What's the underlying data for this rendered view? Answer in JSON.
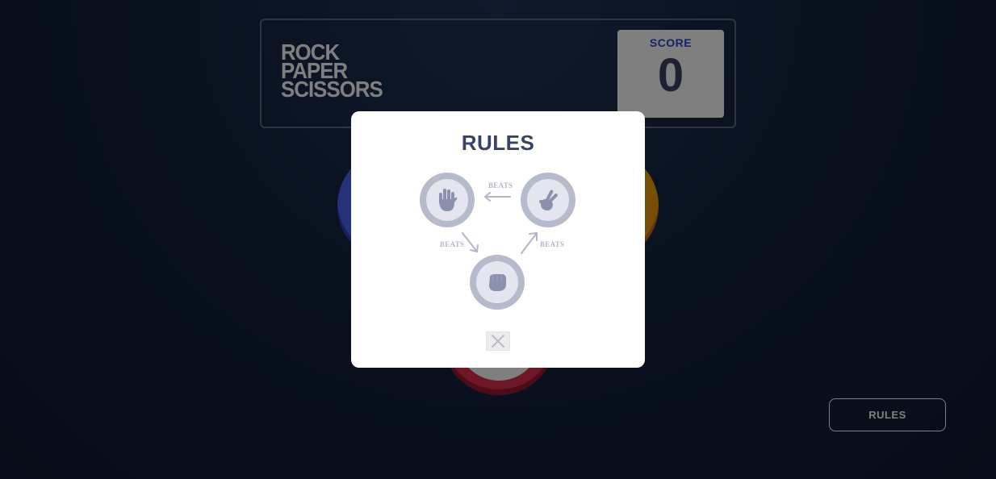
{
  "header": {
    "logo_lines": [
      "ROCK",
      "PAPER",
      "SCISSORS"
    ],
    "score_label": "SCORE",
    "score_value": "0"
  },
  "board": {
    "tokens": [
      {
        "name": "paper",
        "color": "#4865f4"
      },
      {
        "name": "scissors",
        "color": "#ec9e0e"
      },
      {
        "name": "rock",
        "color": "#dc2e4e"
      }
    ]
  },
  "rules_button": {
    "label": "RULES"
  },
  "modal": {
    "title": "RULES",
    "relations": [
      {
        "winner": "scissors",
        "loser": "paper",
        "label": "BEATS"
      },
      {
        "winner": "paper",
        "loser": "rock",
        "label": "BEATS"
      },
      {
        "winner": "rock",
        "loser": "scissors",
        "label": "BEATS"
      }
    ],
    "close_icon": "close-icon"
  },
  "colors": {
    "background": "#15233f",
    "score_text": "#3b4363",
    "score_label": "#2a46c0",
    "modal_icon_ring": "#b7bacb"
  }
}
